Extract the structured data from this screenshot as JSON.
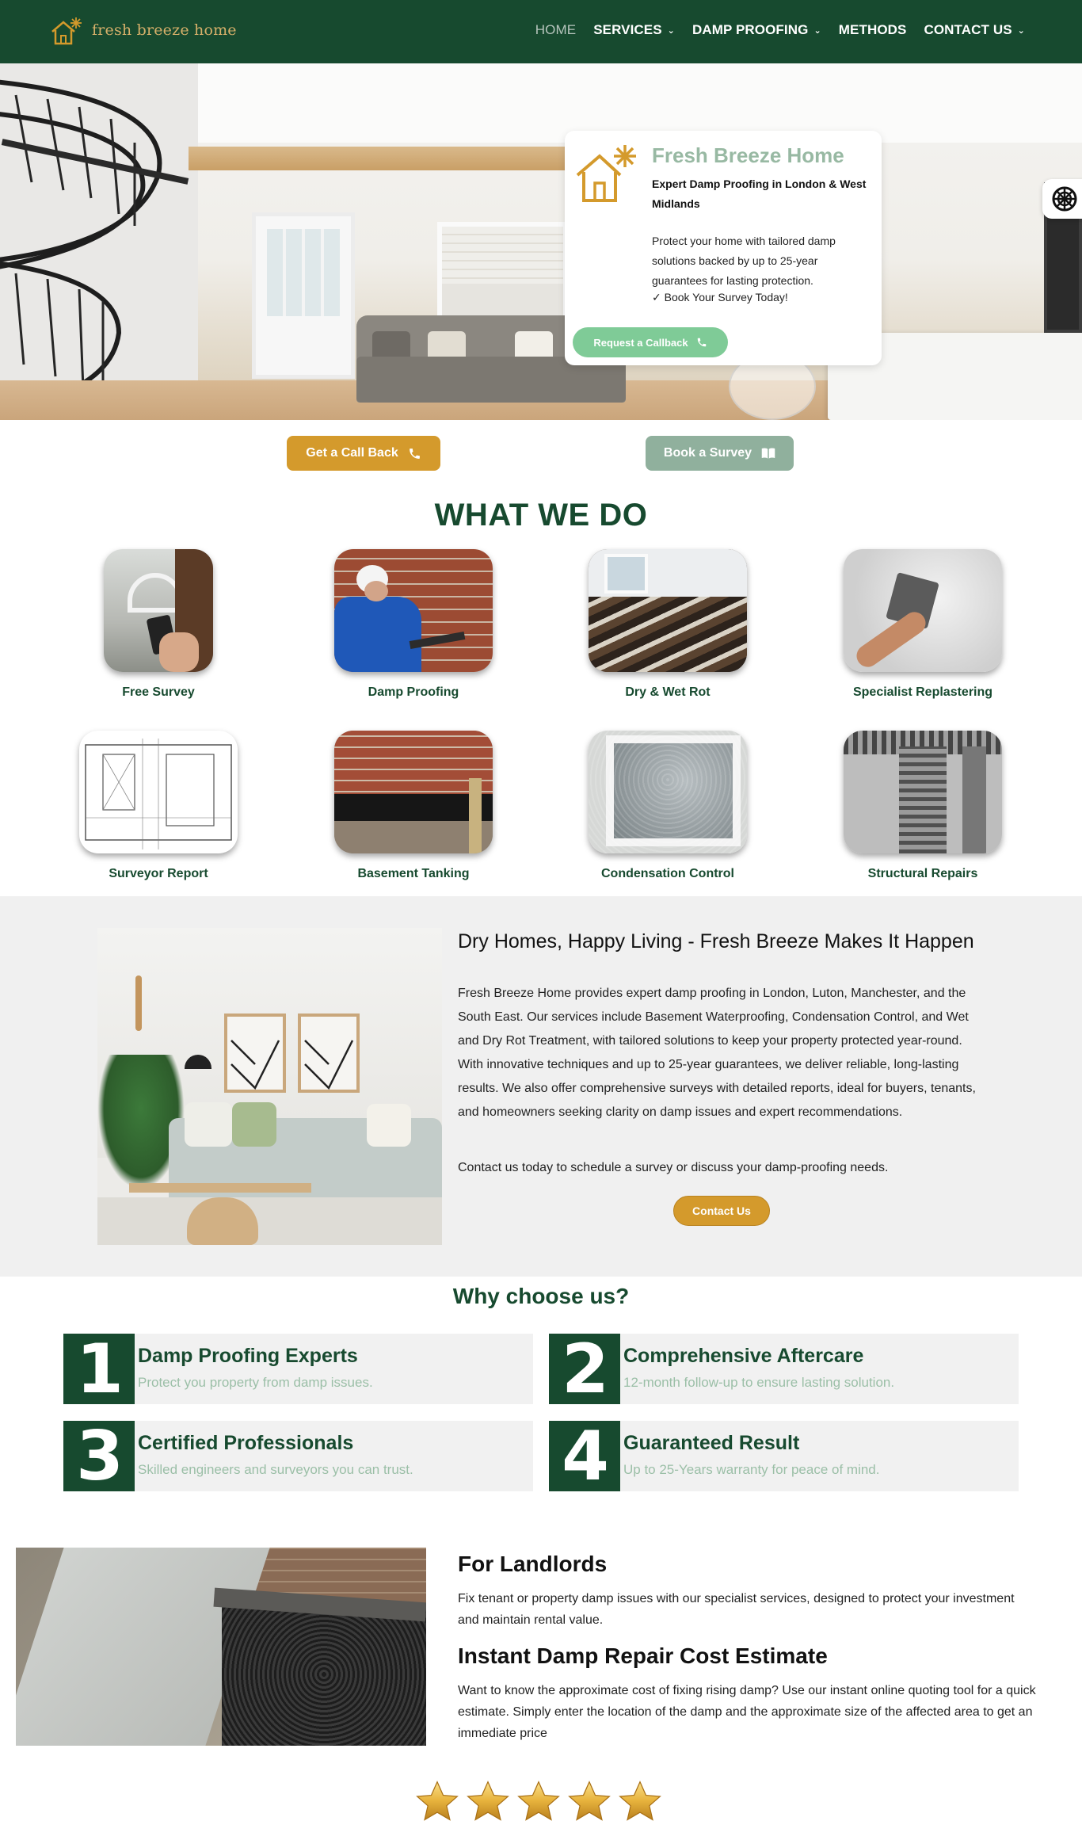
{
  "brand": {
    "name": "fresh breeze home"
  },
  "nav": {
    "items": [
      {
        "label": "HOME",
        "active": true,
        "has_caret": false
      },
      {
        "label": "SERVICES",
        "active": false,
        "has_caret": true
      },
      {
        "label": "DAMP PROOFING",
        "active": false,
        "has_caret": true
      },
      {
        "label": "METHODS",
        "active": false,
        "has_caret": false
      },
      {
        "label": "CONTACT US",
        "active": false,
        "has_caret": true
      }
    ]
  },
  "hero": {
    "title": "Fresh Breeze Home",
    "subtitle": "Expert Damp Proofing in London & West Midlands",
    "body": "Protect your home with tailored damp solutions backed by up to 25-year guarantees for lasting protection.",
    "check": "✓ Book Your Survey Today!",
    "callback_button": "Request a Callback"
  },
  "actions": {
    "call_back": "Get a Call Back",
    "book_survey": "Book a Survey"
  },
  "services": {
    "title": "WHAT WE DO",
    "items": [
      {
        "label": "Free Survey"
      },
      {
        "label": "Damp Proofing"
      },
      {
        "label": "Dry & Wet Rot"
      },
      {
        "label": "Specialist Replastering"
      },
      {
        "label": "Surveyor Report"
      },
      {
        "label": "Basement Tanking"
      },
      {
        "label": "Condensation Control"
      },
      {
        "label": "Structural Repairs"
      }
    ]
  },
  "intro": {
    "heading": "Dry Homes, Happy Living - Fresh Breeze Makes It Happen",
    "paragraph": "Fresh Breeze Home provides expert damp proofing in London, Luton, Manchester, and the South East. Our services include Basement Waterproofing, Condensation Control, and Wet and Dry Rot Treatment, with tailored solutions to keep your property protected year-round. With innovative techniques and up to 25-year guarantees, we deliver reliable, long-lasting results. We also offer comprehensive surveys with detailed reports, ideal for buyers, tenants, and homeowners seeking clarity on damp issues and expert recommendations.",
    "paragraph2": "Contact us today to schedule a survey or discuss your damp-proofing needs.",
    "button": "Contact Us"
  },
  "why": {
    "title": "Why choose us?",
    "items": [
      {
        "num": "1",
        "heading": "Damp Proofing Experts",
        "sub": "Protect you property from damp issues."
      },
      {
        "num": "2",
        "heading": "Comprehensive Aftercare",
        "sub": "12-month follow-up to ensure lasting solution."
      },
      {
        "num": "3",
        "heading": "Certified Professionals",
        "sub": "Skilled engineers and surveyors you can trust."
      },
      {
        "num": "4",
        "heading": "Guaranteed Result",
        "sub": "Up to 25-Years warranty for peace of mind."
      }
    ]
  },
  "landlords": {
    "heading": "For Landlords",
    "text": "Fix tenant or property damp issues with our specialist services, designed to protect your investment and maintain rental value.",
    "estimate_heading": "Instant Damp Repair Cost Estimate",
    "estimate_text": "Want to know the approximate cost of fixing rising damp? Use our instant online quoting tool for a quick estimate. Simply enter the location of the damp and the approximate size of the affected area to get an immediate price"
  },
  "rating": {
    "stars": 5
  },
  "colors": {
    "brand_green": "#174a2f",
    "accent_gold": "#d49a2c",
    "sage": "#90b09d",
    "mint": "#7fcb97"
  }
}
